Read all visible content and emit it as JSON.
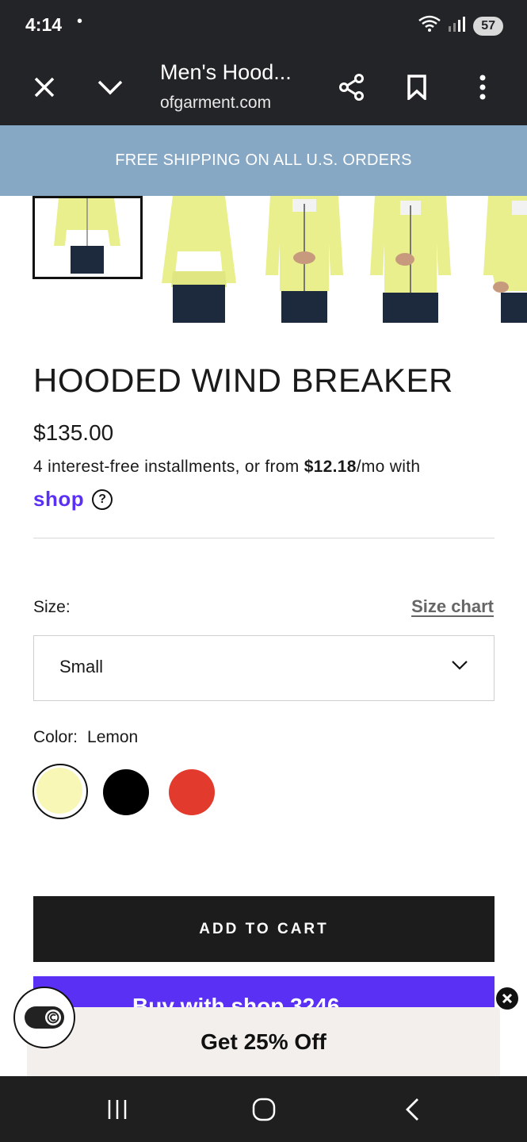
{
  "status_bar": {
    "time": "4:14",
    "dot": "•",
    "battery": "57",
    "wifi_icon": "wifi-icon",
    "signal_icon": "signal-icon"
  },
  "browser": {
    "title": "Men's Hood...",
    "url": "ofgarment.com",
    "icons": [
      "close-icon",
      "chevron-down-icon",
      "share-icon",
      "bookmark-icon",
      "more-icon"
    ]
  },
  "banner": {
    "text": "FREE SHIPPING ON ALL U.S. ORDERS"
  },
  "product": {
    "title": "HOODED WIND BREAKER",
    "price": "$135.00",
    "installments_prefix": "4 interest-free installments, or from ",
    "installments_amount": "$12.18",
    "installments_suffix": "/mo with",
    "shop_logo": "shop",
    "help_symbol": "?"
  },
  "size": {
    "label": "Size:",
    "chart_link": "Size chart",
    "selected": "Small"
  },
  "color": {
    "label": "Color:",
    "selected": "Lemon",
    "swatches": [
      {
        "name": "Lemon",
        "hex": "#f8f7b6"
      },
      {
        "name": "Black",
        "hex": "#000000"
      },
      {
        "name": "Red",
        "hex": "#e23a2c"
      }
    ]
  },
  "actions": {
    "add_to_cart": "ADD TO CART",
    "buy_with_shop": "Buy with shop  3246"
  },
  "promo": {
    "text": "Get 25% Off"
  },
  "colors": {
    "jacket": "#e8ef8c",
    "shop_purple": "#5a31f4",
    "banner": "#87a8c4"
  }
}
